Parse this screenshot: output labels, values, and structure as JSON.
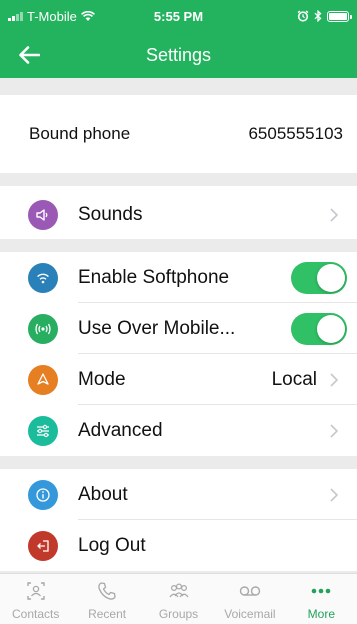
{
  "status_bar": {
    "carrier": "T-Mobile",
    "time": "5:55 PM"
  },
  "nav": {
    "title": "Settings",
    "back_icon": "arrow-left-icon"
  },
  "bound_phone": {
    "label": "Bound phone",
    "value": "6505555103"
  },
  "rows": {
    "sounds": {
      "label": "Sounds",
      "icon": "speaker-icon",
      "color": "#9b59b6"
    },
    "enable_softphone": {
      "label": "Enable Softphone",
      "icon": "wifi-icon",
      "color": "#2a80b9",
      "toggle_on": true
    },
    "use_over_mobile": {
      "label": "Use Over Mobile...",
      "icon": "antenna-icon",
      "color": "#27ae60",
      "toggle_on": true
    },
    "mode": {
      "label": "Mode",
      "value": "Local",
      "icon": "location-icon",
      "color": "#e67e22"
    },
    "advanced": {
      "label": "Advanced",
      "icon": "sliders-icon",
      "color": "#1abc9c"
    },
    "about": {
      "label": "About",
      "icon": "info-icon",
      "color": "#3498db"
    },
    "logout": {
      "label": "Log Out",
      "icon": "logout-icon",
      "color": "#c0392b"
    }
  },
  "tabs": [
    {
      "label": "Contacts",
      "icon": "contacts-icon"
    },
    {
      "label": "Recent",
      "icon": "phone-icon"
    },
    {
      "label": "Groups",
      "icon": "groups-icon"
    },
    {
      "label": "Voicemail",
      "icon": "voicemail-icon"
    },
    {
      "label": "More",
      "icon": "more-icon",
      "active": true
    }
  ],
  "colors": {
    "brand_green": "#23b35f",
    "toggle_on": "#30c066",
    "active_tab": "#23a35a",
    "inactive_tab": "#a8a8a8"
  }
}
